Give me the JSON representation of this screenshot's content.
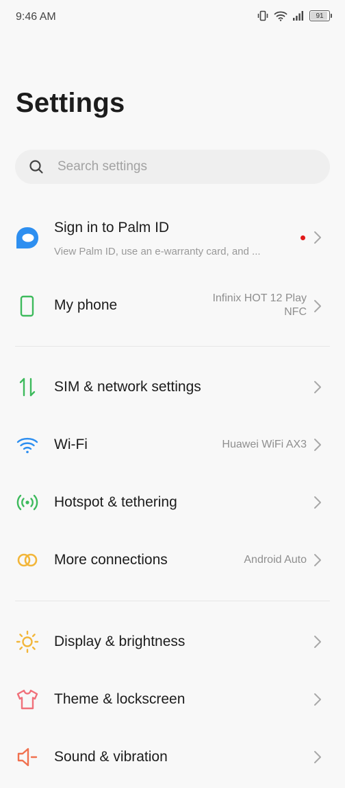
{
  "status_bar": {
    "time": "9:46 AM",
    "battery_level": "91",
    "icons": [
      "vibrate-icon",
      "wifi-icon",
      "signal-icon",
      "battery-icon"
    ]
  },
  "page": {
    "title": "Settings"
  },
  "search": {
    "placeholder": "Search settings",
    "value": ""
  },
  "colors": {
    "palm_id": "#2e8ff0",
    "my_phone": "#3dba5c",
    "sim": "#3dba5c",
    "wifi": "#2e8ff0",
    "hotspot": "#3dba5c",
    "more_connections": "#f2b63a",
    "display": "#f2b63a",
    "theme": "#f0707a",
    "sound": "#f0704e",
    "notification_dot": "#e11919"
  },
  "account": {
    "title": "Sign in to Palm ID",
    "subtitle": "View Palm ID, use an e-warranty card, and ...",
    "icon": "chat-bubble-icon",
    "has_notification": true
  },
  "my_phone": {
    "label": "My phone",
    "value_line1": "Infinix HOT 12 Play",
    "value_line2": "NFC",
    "icon": "phone-icon"
  },
  "connectivity": [
    {
      "label": "SIM & network settings",
      "value": "",
      "icon": "sim-arrows-icon"
    },
    {
      "label": "Wi-Fi",
      "value": "Huawei WiFi AX3",
      "icon": "wifi-icon"
    },
    {
      "label": "Hotspot & tethering",
      "value": "",
      "icon": "hotspot-icon"
    },
    {
      "label": "More connections",
      "value": "Android Auto",
      "icon": "link-rings-icon"
    }
  ],
  "device": [
    {
      "label": "Display & brightness",
      "icon": "sun-icon"
    },
    {
      "label": "Theme & lockscreen",
      "icon": "tshirt-icon"
    },
    {
      "label": "Sound & vibration",
      "icon": "speaker-icon"
    }
  ]
}
